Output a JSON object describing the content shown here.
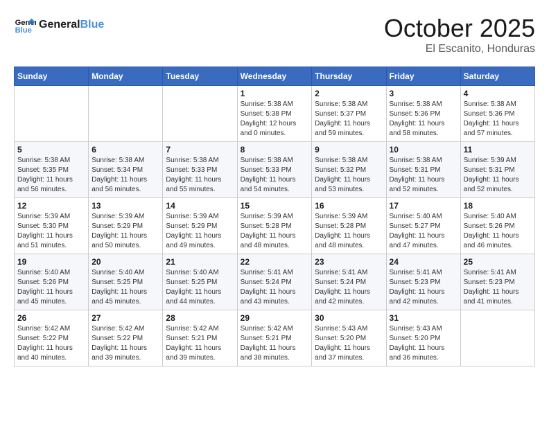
{
  "header": {
    "logo_line1": "General",
    "logo_line2": "Blue",
    "title": "October 2025",
    "subtitle": "El Escanito, Honduras"
  },
  "days_of_week": [
    "Sunday",
    "Monday",
    "Tuesday",
    "Wednesday",
    "Thursday",
    "Friday",
    "Saturday"
  ],
  "weeks": [
    [
      {
        "day": "",
        "info": ""
      },
      {
        "day": "",
        "info": ""
      },
      {
        "day": "",
        "info": ""
      },
      {
        "day": "1",
        "info": "Sunrise: 5:38 AM\nSunset: 5:38 PM\nDaylight: 12 hours\nand 0 minutes."
      },
      {
        "day": "2",
        "info": "Sunrise: 5:38 AM\nSunset: 5:37 PM\nDaylight: 11 hours\nand 59 minutes."
      },
      {
        "day": "3",
        "info": "Sunrise: 5:38 AM\nSunset: 5:36 PM\nDaylight: 11 hours\nand 58 minutes."
      },
      {
        "day": "4",
        "info": "Sunrise: 5:38 AM\nSunset: 5:36 PM\nDaylight: 11 hours\nand 57 minutes."
      }
    ],
    [
      {
        "day": "5",
        "info": "Sunrise: 5:38 AM\nSunset: 5:35 PM\nDaylight: 11 hours\nand 56 minutes."
      },
      {
        "day": "6",
        "info": "Sunrise: 5:38 AM\nSunset: 5:34 PM\nDaylight: 11 hours\nand 56 minutes."
      },
      {
        "day": "7",
        "info": "Sunrise: 5:38 AM\nSunset: 5:33 PM\nDaylight: 11 hours\nand 55 minutes."
      },
      {
        "day": "8",
        "info": "Sunrise: 5:38 AM\nSunset: 5:33 PM\nDaylight: 11 hours\nand 54 minutes."
      },
      {
        "day": "9",
        "info": "Sunrise: 5:38 AM\nSunset: 5:32 PM\nDaylight: 11 hours\nand 53 minutes."
      },
      {
        "day": "10",
        "info": "Sunrise: 5:38 AM\nSunset: 5:31 PM\nDaylight: 11 hours\nand 52 minutes."
      },
      {
        "day": "11",
        "info": "Sunrise: 5:39 AM\nSunset: 5:31 PM\nDaylight: 11 hours\nand 52 minutes."
      }
    ],
    [
      {
        "day": "12",
        "info": "Sunrise: 5:39 AM\nSunset: 5:30 PM\nDaylight: 11 hours\nand 51 minutes."
      },
      {
        "day": "13",
        "info": "Sunrise: 5:39 AM\nSunset: 5:29 PM\nDaylight: 11 hours\nand 50 minutes."
      },
      {
        "day": "14",
        "info": "Sunrise: 5:39 AM\nSunset: 5:29 PM\nDaylight: 11 hours\nand 49 minutes."
      },
      {
        "day": "15",
        "info": "Sunrise: 5:39 AM\nSunset: 5:28 PM\nDaylight: 11 hours\nand 48 minutes."
      },
      {
        "day": "16",
        "info": "Sunrise: 5:39 AM\nSunset: 5:28 PM\nDaylight: 11 hours\nand 48 minutes."
      },
      {
        "day": "17",
        "info": "Sunrise: 5:40 AM\nSunset: 5:27 PM\nDaylight: 11 hours\nand 47 minutes."
      },
      {
        "day": "18",
        "info": "Sunrise: 5:40 AM\nSunset: 5:26 PM\nDaylight: 11 hours\nand 46 minutes."
      }
    ],
    [
      {
        "day": "19",
        "info": "Sunrise: 5:40 AM\nSunset: 5:26 PM\nDaylight: 11 hours\nand 45 minutes."
      },
      {
        "day": "20",
        "info": "Sunrise: 5:40 AM\nSunset: 5:25 PM\nDaylight: 11 hours\nand 45 minutes."
      },
      {
        "day": "21",
        "info": "Sunrise: 5:40 AM\nSunset: 5:25 PM\nDaylight: 11 hours\nand 44 minutes."
      },
      {
        "day": "22",
        "info": "Sunrise: 5:41 AM\nSunset: 5:24 PM\nDaylight: 11 hours\nand 43 minutes."
      },
      {
        "day": "23",
        "info": "Sunrise: 5:41 AM\nSunset: 5:24 PM\nDaylight: 11 hours\nand 42 minutes."
      },
      {
        "day": "24",
        "info": "Sunrise: 5:41 AM\nSunset: 5:23 PM\nDaylight: 11 hours\nand 42 minutes."
      },
      {
        "day": "25",
        "info": "Sunrise: 5:41 AM\nSunset: 5:23 PM\nDaylight: 11 hours\nand 41 minutes."
      }
    ],
    [
      {
        "day": "26",
        "info": "Sunrise: 5:42 AM\nSunset: 5:22 PM\nDaylight: 11 hours\nand 40 minutes."
      },
      {
        "day": "27",
        "info": "Sunrise: 5:42 AM\nSunset: 5:22 PM\nDaylight: 11 hours\nand 39 minutes."
      },
      {
        "day": "28",
        "info": "Sunrise: 5:42 AM\nSunset: 5:21 PM\nDaylight: 11 hours\nand 39 minutes."
      },
      {
        "day": "29",
        "info": "Sunrise: 5:42 AM\nSunset: 5:21 PM\nDaylight: 11 hours\nand 38 minutes."
      },
      {
        "day": "30",
        "info": "Sunrise: 5:43 AM\nSunset: 5:20 PM\nDaylight: 11 hours\nand 37 minutes."
      },
      {
        "day": "31",
        "info": "Sunrise: 5:43 AM\nSunset: 5:20 PM\nDaylight: 11 hours\nand 36 minutes."
      },
      {
        "day": "",
        "info": ""
      }
    ]
  ]
}
